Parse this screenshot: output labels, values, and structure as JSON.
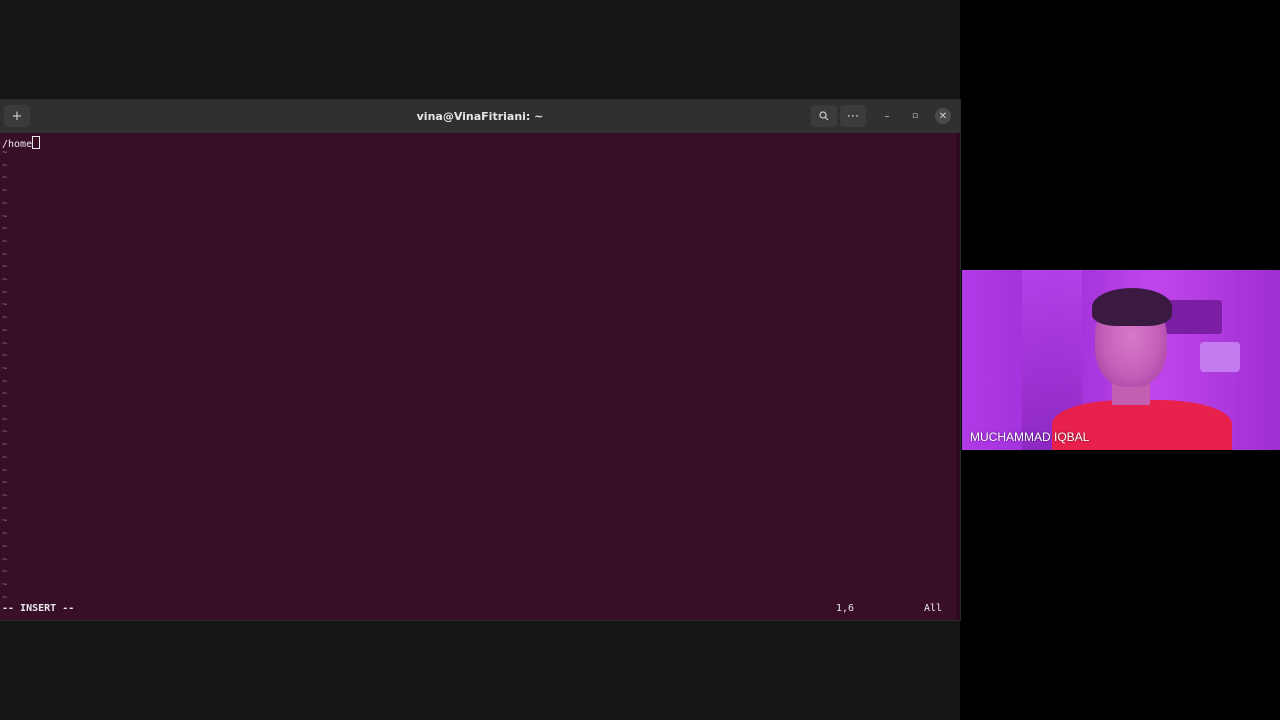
{
  "terminal": {
    "title": "vina@VinaFitriani: ~",
    "buffer_text": "/home",
    "tilde_lines": "~\n~\n~\n~\n~\n~\n~\n~\n~\n~\n~\n~\n~\n~\n~\n~\n~\n~\n~\n~\n~\n~\n~\n~\n~\n~\n~\n~\n~\n~\n~\n~\n~\n~\n~\n~",
    "mode": "-- INSERT --",
    "cursor_pos": "1,6",
    "scroll": "All",
    "icons": {
      "new_tab": "plus-icon",
      "search": "search-icon",
      "menu": "ellipsis-icon",
      "minimize": "minimize-icon",
      "maximize": "maximize-icon",
      "close": "close-icon"
    }
  },
  "video": {
    "participant_name": "MUCHAMMAD IQBAL"
  },
  "colors": {
    "terminal_bg": "#380f26",
    "titlebar_bg": "#303030",
    "desktop_bg": "#161616"
  }
}
